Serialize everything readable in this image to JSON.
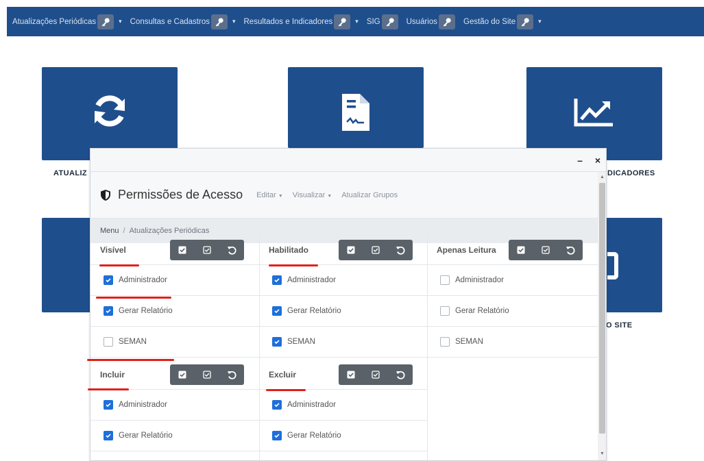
{
  "nav": {
    "items": [
      {
        "label": "Atualizações Periódicas"
      },
      {
        "label": "Consultas e Cadastros"
      },
      {
        "label": "Resultados e Indicadores"
      },
      {
        "label": "SIG"
      },
      {
        "label": "Usuários"
      },
      {
        "label": "Gestão do Site"
      }
    ]
  },
  "tiles": {
    "t1_label": "ATUALIZ",
    "t3_label": "DICADORES",
    "t6_label": "O SITE"
  },
  "modal": {
    "minimize": "–",
    "close": "×",
    "title": "Permissões de Acesso",
    "menu_edit": "Editar",
    "menu_view": "Visualizar",
    "menu_update_groups": "Atualizar Grupos",
    "breadcrumb": {
      "root": "Menu",
      "separator": "/",
      "current": "Atualizações Periódicas"
    }
  },
  "panels": {
    "visivel": {
      "title": "Visível",
      "rows": [
        {
          "label": "Administrador",
          "checked": true
        },
        {
          "label": "Gerar Relatório",
          "checked": true
        },
        {
          "label": "SEMAN",
          "checked": false
        }
      ]
    },
    "habilitado": {
      "title": "Habilitado",
      "rows": [
        {
          "label": "Administrador",
          "checked": true
        },
        {
          "label": "Gerar Relatório",
          "checked": true
        },
        {
          "label": "SEMAN",
          "checked": true
        }
      ]
    },
    "apenas_leitura": {
      "title": "Apenas Leitura",
      "rows": [
        {
          "label": "Administrador",
          "checked": false
        },
        {
          "label": "Gerar Relatório",
          "checked": false
        },
        {
          "label": "SEMAN",
          "checked": false
        }
      ]
    },
    "incluir": {
      "title": "Incluir",
      "rows": [
        {
          "label": "Administrador",
          "checked": true
        },
        {
          "label": "Gerar Relatório",
          "checked": true
        }
      ]
    },
    "excluir": {
      "title": "Excluir",
      "rows": [
        {
          "label": "Administrador",
          "checked": true
        },
        {
          "label": "Gerar Relatório",
          "checked": true
        }
      ]
    }
  },
  "colors": {
    "navbar": "#1f4e8c",
    "tile": "#1f4e8c",
    "checkbox": "#1e6fd9",
    "annotation": "#e0201b"
  }
}
